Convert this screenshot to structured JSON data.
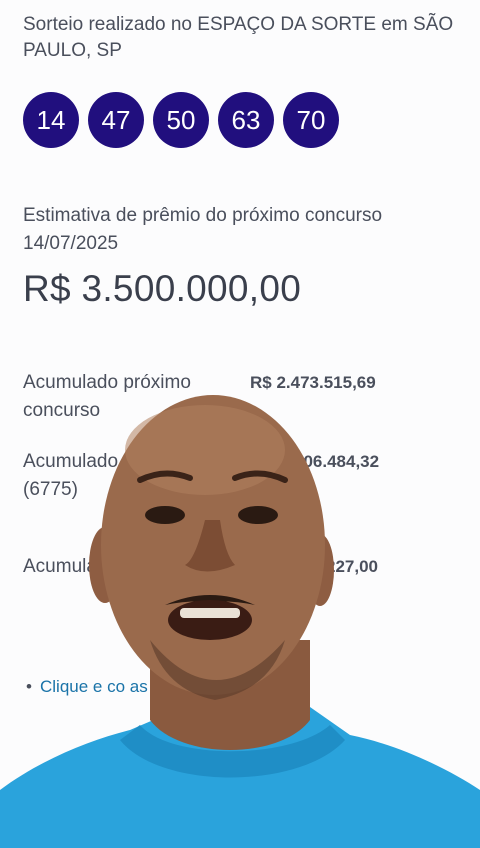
{
  "draw_location": "Sorteio realizado no ESPAÇO DA SORTE em SÃO PAULO, SP",
  "numbers": [
    "14",
    "47",
    "50",
    "63",
    "70"
  ],
  "estimate": {
    "label": "Estimativa de prêmio do próximo concurso 14/07/2025",
    "value": "R$ 3.500.000,00"
  },
  "accumulated": [
    {
      "label": "Acumulado próximo concurso",
      "value": "R$ 2.473.515,69"
    },
    {
      "label": "Acumulado p concurso fi (6775)",
      "value": "406.484,32"
    },
    {
      "label": "Acumula Sorteio E João",
      "value": "227,00"
    }
  ],
  "link_text": "Clique e co as apostas ganhadoras",
  "colors": {
    "ball": "#210f7e",
    "link": "#1a73a8",
    "shirt": "#2aa3dc"
  }
}
